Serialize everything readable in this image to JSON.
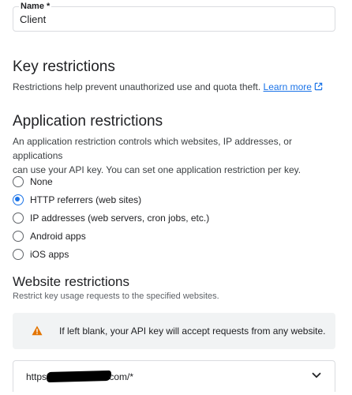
{
  "name_field": {
    "label": "Name *",
    "value": "Client"
  },
  "key_restrictions": {
    "heading": "Key restrictions",
    "description": "Restrictions help prevent unauthorized use and quota theft.",
    "learn_more": "Learn more"
  },
  "application_restrictions": {
    "heading": "Application restrictions",
    "description_line1": "An application restriction controls which websites, IP addresses, or applications",
    "description_line2": "can use your API key. You can set one application restriction per key.",
    "options": [
      {
        "label": "None",
        "selected": false
      },
      {
        "label": "HTTP referrers (web sites)",
        "selected": true
      },
      {
        "label": "IP addresses (web servers, cron jobs, etc.)",
        "selected": false
      },
      {
        "label": "Android apps",
        "selected": false
      },
      {
        "label": "iOS apps",
        "selected": false
      }
    ]
  },
  "website_restrictions": {
    "heading": "Website restrictions",
    "subtitle": "Restrict key usage requests to the specified websites.",
    "notice": "If left blank, your API key will accept requests from any website.",
    "items": [
      {
        "url_prefix": "https:",
        "url_suffix": "com/*"
      }
    ]
  },
  "colors": {
    "accent": "#1a73e8",
    "warning": "#e37400"
  },
  "icons": {
    "learn_more": "external-link-icon",
    "notice": "warning-icon",
    "item_toggle": "chevron-down-icon"
  }
}
